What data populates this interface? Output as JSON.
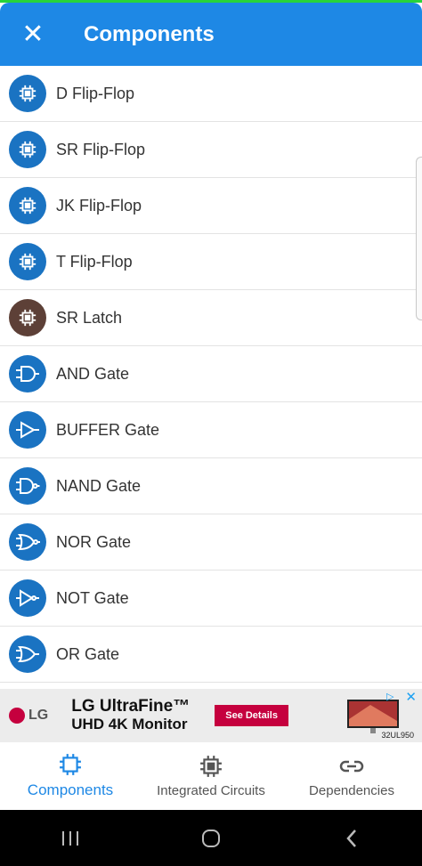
{
  "header": {
    "title": "Components"
  },
  "components": [
    {
      "label": "D Flip-Flop",
      "icon": "chip-icon",
      "color": "#1a73c2"
    },
    {
      "label": "SR Flip-Flop",
      "icon": "chip-icon",
      "color": "#1a73c2"
    },
    {
      "label": "JK Flip-Flop",
      "icon": "chip-icon",
      "color": "#1a73c2"
    },
    {
      "label": "T Flip-Flop",
      "icon": "chip-icon",
      "color": "#1a73c2"
    },
    {
      "label": "SR Latch",
      "icon": "chip-icon",
      "color": "#5d4037"
    },
    {
      "label": "AND Gate",
      "icon": "and-gate-icon",
      "color": "#1a73c2"
    },
    {
      "label": "BUFFER Gate",
      "icon": "buffer-gate-icon",
      "color": "#1a73c2"
    },
    {
      "label": "NAND Gate",
      "icon": "nand-gate-icon",
      "color": "#1a73c2"
    },
    {
      "label": "NOR Gate",
      "icon": "nor-gate-icon",
      "color": "#1a73c2"
    },
    {
      "label": "NOT Gate",
      "icon": "not-gate-icon",
      "color": "#1a73c2"
    },
    {
      "label": "OR Gate",
      "icon": "or-gate-icon",
      "color": "#1a73c2"
    }
  ],
  "ad": {
    "brand": "LG",
    "title": "LG UltraFine™",
    "subtitle": "UHD 4K Monitor",
    "cta": "See Details",
    "model": "32UL950"
  },
  "tabs": [
    {
      "label": "Components",
      "icon": "chip-icon",
      "active": true
    },
    {
      "label": "Integrated Circuits",
      "icon": "chip-icon",
      "active": false
    },
    {
      "label": "Dependencies",
      "icon": "link-icon",
      "active": false
    }
  ],
  "colors": {
    "primary": "#1e88e5",
    "icon_blue": "#1a73c2",
    "icon_brown": "#5d4037",
    "ad_red": "#c5003e"
  }
}
